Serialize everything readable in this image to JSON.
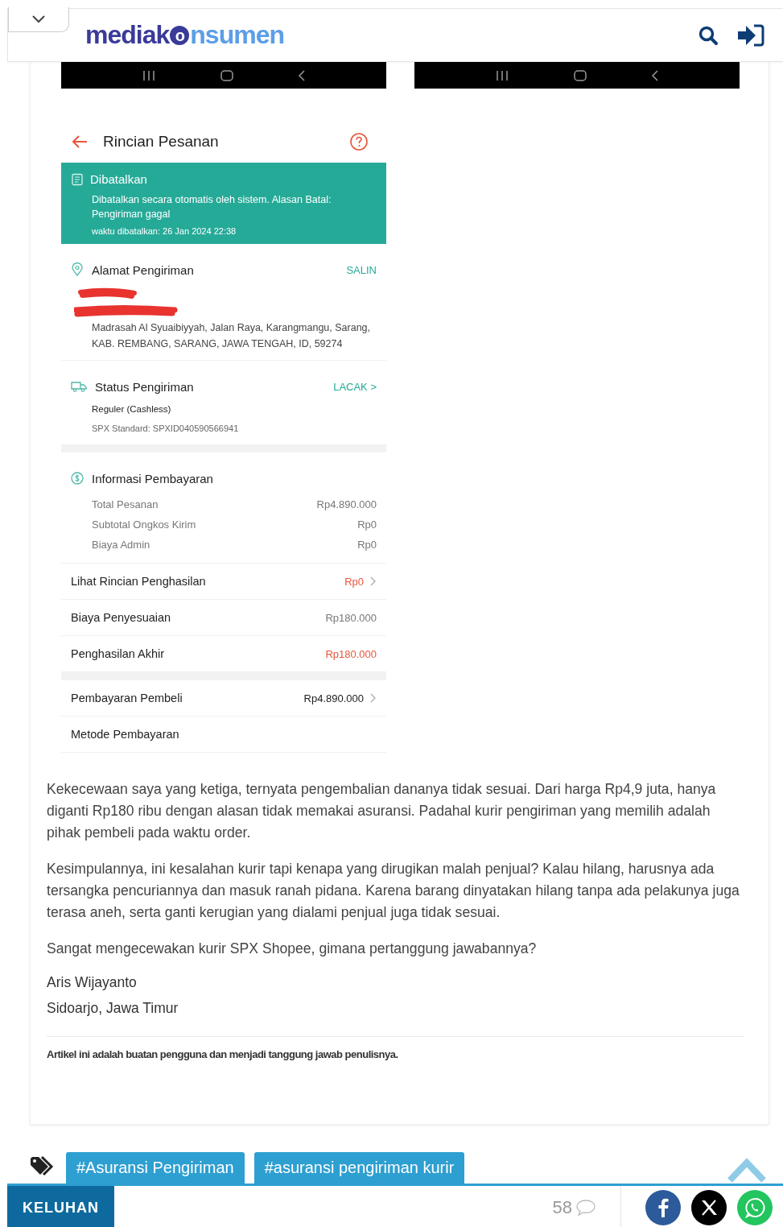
{
  "header": {
    "logo": {
      "first": "mediak",
      "mark": "o",
      "last": "nsumen"
    }
  },
  "order": {
    "title": "Rincian Pesanan",
    "status": {
      "title": "Dibatalkan",
      "message": "Dibatalkan secara otomatis oleh sistem. Alasan Batal: Pengiriman gagal",
      "time": "waktu dibatalkan: 26 Jan 2024 22:38"
    },
    "address": {
      "title": "Alamat Pengiriman",
      "action": "SALIN",
      "text": "Madrasah Al Syuaibiyyah, Jalan Raya, Karangmangu, Sarang, KAB. REMBANG, SARANG, JAWA TENGAH, ID, 59274"
    },
    "shipping": {
      "title": "Status Pengiriman",
      "action": "LACAK >",
      "service": "Reguler (Cashless)",
      "tracking": "SPX Standard: SPXID040590566941"
    },
    "payment": {
      "title": "Informasi Pembayaran",
      "lines": [
        {
          "label": "Total Pesanan",
          "value": "Rp4.890.000"
        },
        {
          "label": "Subtotal Ongkos Kirim",
          "value": "Rp0"
        },
        {
          "label": "Biaya Admin",
          "value": "Rp0"
        }
      ]
    },
    "rows": [
      {
        "label": "Lihat Rincian Penghasilan",
        "value": "Rp0",
        "highlight": true,
        "chevron": true,
        "gap_before": false
      },
      {
        "label": "Biaya Penyesuaian",
        "value": "Rp180.000",
        "highlight": false,
        "chevron": false,
        "gap_before": false
      },
      {
        "label": "Penghasilan Akhir",
        "value": "Rp180.000",
        "highlight": true,
        "chevron": false,
        "gap_before": false
      },
      {
        "label": "Pembayaran Pembeli",
        "value": "Rp4.890.000",
        "highlight": false,
        "chevron": true,
        "gap_before": true
      },
      {
        "label": "Metode Pembayaran",
        "chevron": false,
        "gap_before": false
      }
    ]
  },
  "article": {
    "paragraphs": [
      "Kekecewaan saya yang ketiga, ternyata pengembalian dananya tidak sesuai. Dari harga Rp4,9 juta, hanya diganti Rp180 ribu dengan alasan tidak memakai asuransi. Padahal kurir pengiriman yang memilih adalah pihak pembeli pada waktu order.",
      "Kesimpulannya, ini kesalahan kurir tapi kenapa yang dirugikan malah penjual? Kalau hilang, harusnya ada tersangka pencuriannya dan masuk ranah pidana. Karena barang dinyatakan hilang tanpa ada pelakunya juga terasa aneh, serta ganti kerugian yang dialami penjual juga tidak sesuai.",
      "Sangat mengecewakan kurir SPX Shopee, gimana pertanggung jawabannya?"
    ],
    "author": "Aris Wijayanto",
    "location": "Sidoarjo, Jawa Timur",
    "disclaimer": "Artikel ini adalah buatan pengguna dan menjadi tanggung jawab penulisnya."
  },
  "tags": [
    "#Asuransi Pengiriman",
    "#asuransi pengiriman kurir"
  ],
  "bottom_bar": {
    "category": "KELUHAN",
    "comments": "58"
  }
}
